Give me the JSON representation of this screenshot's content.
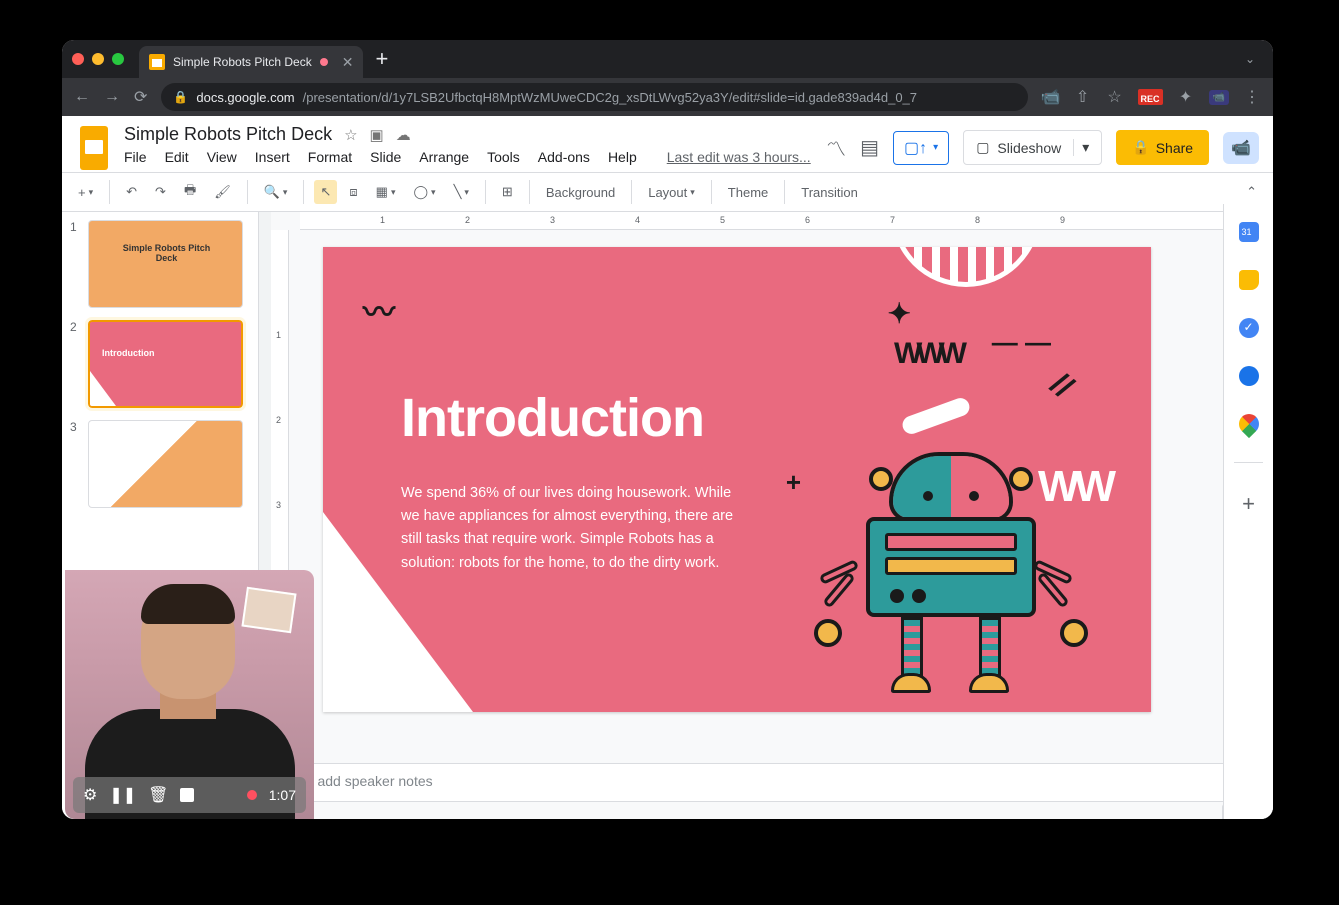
{
  "browser": {
    "tab_title": "Simple Robots Pitch Deck",
    "url_host": "docs.google.com",
    "url_path": "/presentation/d/1y7LSB2UfbctqH8MptWzMUweCDC2g_xsDtLWvg52ya3Y/edit#slide=id.gade839ad4d_0_7"
  },
  "doc": {
    "title": "Simple Robots Pitch Deck",
    "last_edit": "Last edit was 3 hours..."
  },
  "menus": {
    "file": "File",
    "edit": "Edit",
    "view": "View",
    "insert": "Insert",
    "format": "Format",
    "slide": "Slide",
    "arrange": "Arrange",
    "tools": "Tools",
    "addons": "Add-ons",
    "help": "Help"
  },
  "header_buttons": {
    "slideshow": "Slideshow",
    "share": "Share"
  },
  "toolbar": {
    "background": "Background",
    "layout": "Layout",
    "theme": "Theme",
    "transition": "Transition"
  },
  "ruler": {
    "h": [
      "1",
      "2",
      "3",
      "4",
      "5",
      "6",
      "7",
      "8",
      "9"
    ],
    "v": [
      "1",
      "2",
      "3"
    ]
  },
  "thumbnails": [
    {
      "num": "1",
      "title": "Simple Robots Pitch Deck"
    },
    {
      "num": "2",
      "title": "Introduction"
    },
    {
      "num": "3",
      "title": ""
    }
  ],
  "slide": {
    "title": "Introduction",
    "body": "We spend 36% of our lives doing housework. While we have appliances for almost everything, there are still tasks that require work. Simple Robots has a solution: robots for the home, to do the dirty work."
  },
  "speaker_notes_placeholder": "k to add speaker notes",
  "webcam": {
    "time": "1:07"
  },
  "colors": {
    "slide_bg": "#e96a7f",
    "accent_orange": "#f2a965",
    "robot_teal": "#2d9b9b",
    "robot_yellow": "#f2b84b",
    "share_yellow": "#fbbc04"
  }
}
